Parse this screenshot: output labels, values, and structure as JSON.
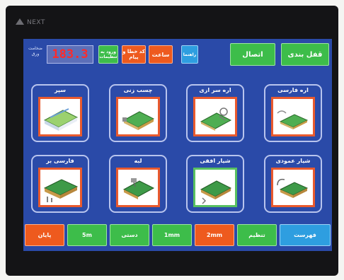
{
  "brand": "NEXT",
  "header": {
    "counter_label": "ضخامت ورق",
    "counter_value": "183.3",
    "btn_green_small": "ورود به تنظیمات",
    "btn_orange_a": "کد خطا و پیام",
    "btn_orange_b": "ساعت",
    "btn_blue_small": "راهنما",
    "btn_right_1": "اتصال",
    "btn_right_2": "قفل بندی"
  },
  "programs": [
    {
      "label": "سپر",
      "selected": false
    },
    {
      "label": "چسب زنی",
      "selected": false
    },
    {
      "label": "اره سر ازی",
      "selected": false
    },
    {
      "label": "اره فارسی",
      "selected": false
    },
    {
      "label": "فارسی بر",
      "selected": false
    },
    {
      "label": "لبه",
      "selected": false
    },
    {
      "label": "شیار افقی",
      "selected": true
    },
    {
      "label": "شیار عمودی",
      "selected": false
    }
  ],
  "footer": [
    {
      "label": "پایان",
      "color": "orange"
    },
    {
      "label": "5m",
      "color": "green"
    },
    {
      "label": "دستی",
      "color": "green"
    },
    {
      "label": "1mm",
      "color": "green"
    },
    {
      "label": "2mm",
      "color": "orange"
    },
    {
      "label": "تنظیم",
      "color": "green"
    },
    {
      "label": "فهرست",
      "color": "blue"
    }
  ]
}
